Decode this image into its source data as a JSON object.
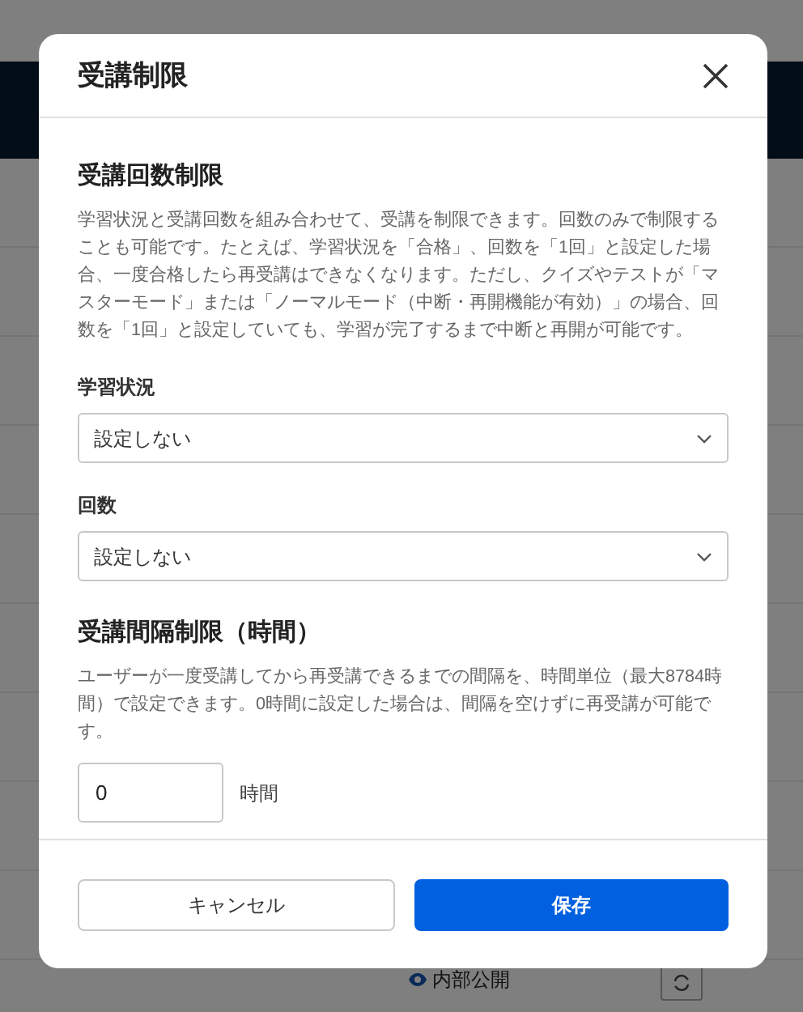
{
  "background": {
    "status_label": "内部公開"
  },
  "dialog": {
    "title": "受講制限",
    "sections": [
      {
        "kind": "selects",
        "heading": "受講回数制限",
        "description": "学習状況と受講回数を組み合わせて、受講を制限できます。回数のみで制限することも可能です。たとえば、学習状況を「合格」、回数を「1回」と設定した場合、一度合格したら再受講はできなくなります。ただし、クイズやテストが「マスターモード」または「ノーマルモード（中断・再開機能が有効）」の場合、回数を「1回」と設定していても、学習が完了するまで中断と再開が可能です。",
        "fields": [
          {
            "label": "学習状況",
            "value": "設定しない"
          },
          {
            "label": "回数",
            "value": "設定しない"
          }
        ]
      },
      {
        "kind": "hours",
        "heading": "受講間隔制限（時間）",
        "description": "ユーザーが一度受講してから再受講できるまでの間隔を、時間単位（最大8784時間）で設定できます。0時間に設定した場合は、間隔を空けずに再受講が可能です。",
        "value": "0",
        "unit": "時間"
      }
    ],
    "buttons": {
      "cancel": "キャンセル",
      "save": "保存"
    }
  }
}
